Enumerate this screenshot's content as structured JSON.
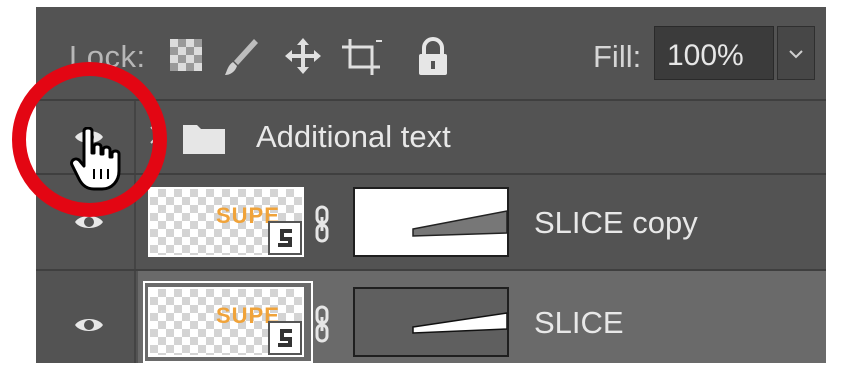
{
  "lock_bar": {
    "lock_label": "Lock:",
    "fill_label": "Fill:",
    "fill_value": "100%",
    "icons": [
      "lock-transparent-pixels-icon",
      "lock-image-pixels-icon",
      "lock-position-icon",
      "lock-artboard-icon",
      "lock-all-icon"
    ]
  },
  "layers": [
    {
      "type": "group",
      "name": "Additional text",
      "visible": true,
      "expanded": false
    },
    {
      "type": "smart-object",
      "name": "SLICE copy",
      "visible": true,
      "thumb_text": "SUPE",
      "has_mask": true,
      "mask_background": "#ffffff",
      "mask_shape_color": "#777777",
      "selected": false
    },
    {
      "type": "smart-object",
      "name": "SLICE",
      "visible": true,
      "thumb_text": "SUPE",
      "has_mask": true,
      "mask_background": "#5f5f5f",
      "mask_shape_color": "#ffffff",
      "selected": true
    }
  ],
  "colors": {
    "panel_bg": "#535353",
    "selected_row": "#6a6a6a",
    "annotation_circle": "#e30613",
    "thumb_text": "#f0a33a"
  }
}
